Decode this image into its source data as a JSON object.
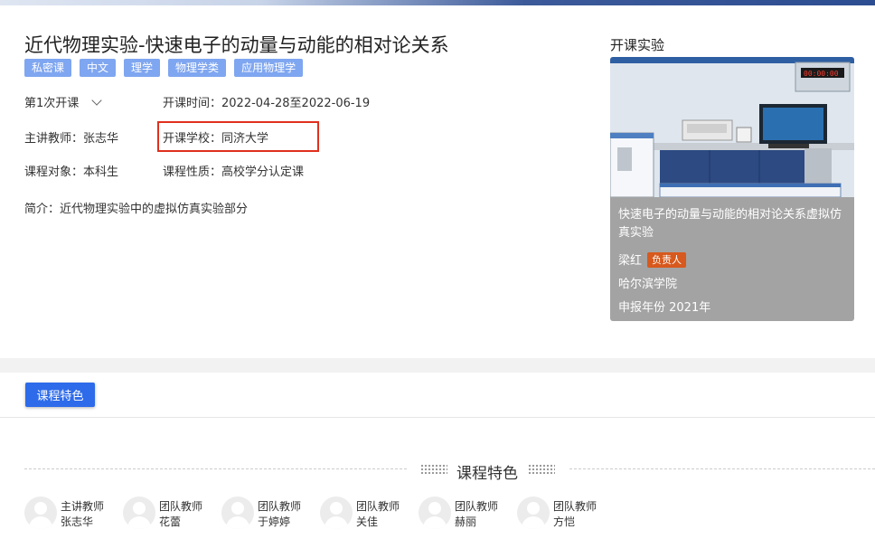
{
  "course": {
    "title": "近代物理实验-快速电子的动量与动能的相对论关系",
    "tags": [
      "私密课",
      "中文",
      "理学",
      "物理学类",
      "应用物理学"
    ],
    "session": "第1次开课",
    "period": "开课时间：2022-04-28至2022-06-19",
    "teacher": "主讲教师：张志华",
    "school": "开课学校：同济大学",
    "audience": "课程对象：本科生",
    "nature": "课程性质：高校学分认定课",
    "intro": "简介：近代物理实验中的虚拟仿真实验部分"
  },
  "experiment": {
    "heading": "开课实验",
    "name": "快速电子的动量与动能的相对论关系虚拟仿真实验",
    "person": "梁红",
    "role_badge": "负责人",
    "school": "哈尔滨学院",
    "year": "申报年份 2021年",
    "display_value": "00:00:00"
  },
  "tabs": {
    "feature": "课程特色"
  },
  "section": {
    "title": "课程特色"
  },
  "teachers": [
    {
      "role": "主讲教师",
      "name": "张志华"
    },
    {
      "role": "团队教师",
      "name": "花蕾"
    },
    {
      "role": "团队教师",
      "name": "于婷婷"
    },
    {
      "role": "团队教师",
      "name": "关佳"
    },
    {
      "role": "团队教师",
      "name": "赫丽"
    },
    {
      "role": "团队教师",
      "name": "方恺"
    }
  ],
  "colors": {
    "tag": "#7fa6f0",
    "button": "#2d6bea",
    "badge": "#d7591d",
    "highlight": "#e0301e",
    "card": "#a3a3a3"
  }
}
